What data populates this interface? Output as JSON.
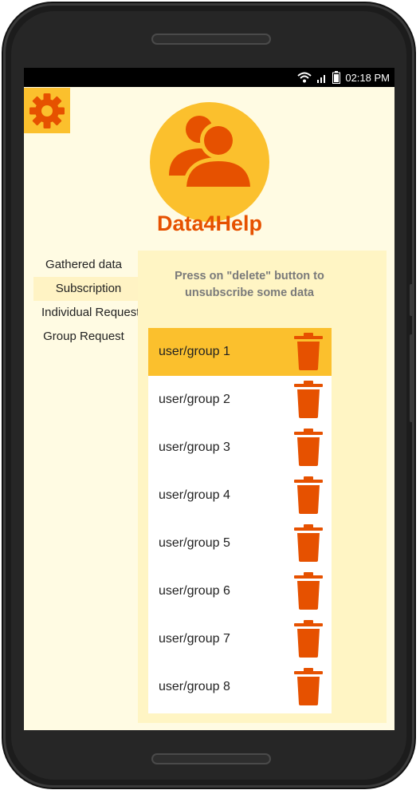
{
  "status_bar": {
    "time": "02:18 PM",
    "icons": [
      "wifi-icon",
      "signal-icon",
      "battery-icon"
    ]
  },
  "app": {
    "title": "Data4Help",
    "settings_icon": "gear-icon",
    "logo_icon": "users-icon"
  },
  "menu": {
    "items": [
      {
        "label": "Gathered data",
        "active": false
      },
      {
        "label": "Subscription",
        "active": true
      },
      {
        "label": "Individual Request",
        "active": false
      },
      {
        "label": "Group Request",
        "active": false
      }
    ]
  },
  "panel": {
    "instruction": "Press on \"delete\" button to unsubscribe some data",
    "subscriptions": [
      {
        "label": "user/group 1",
        "selected": true
      },
      {
        "label": "user/group 2",
        "selected": false
      },
      {
        "label": "user/group 3",
        "selected": false
      },
      {
        "label": "user/group 4",
        "selected": false
      },
      {
        "label": "user/group 5",
        "selected": false
      },
      {
        "label": "user/group 6",
        "selected": false
      },
      {
        "label": "user/group 7",
        "selected": false
      },
      {
        "label": "user/group 8",
        "selected": false
      }
    ],
    "delete_icon": "trash-icon"
  },
  "colors": {
    "accent": "#e65100",
    "highlight": "#fbc02d",
    "background": "#fffbe3",
    "panel": "#fff5c4"
  }
}
